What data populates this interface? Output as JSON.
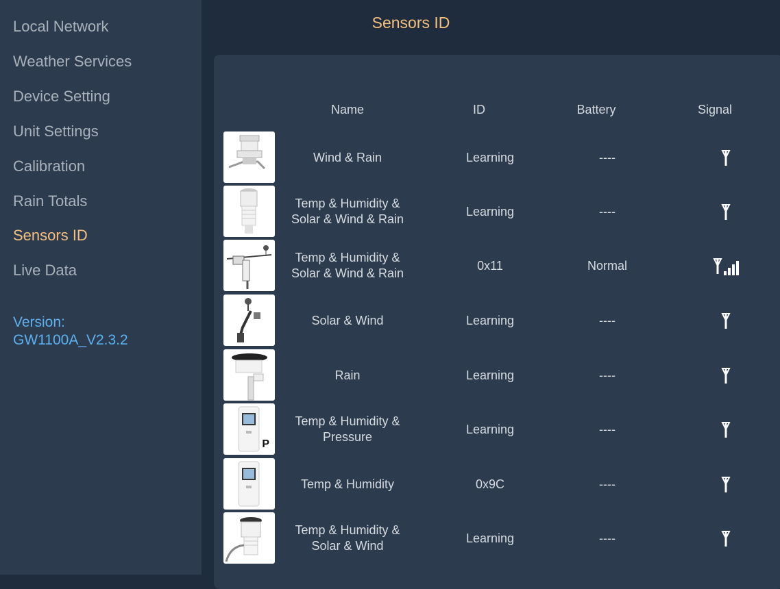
{
  "sidebar": {
    "items": [
      {
        "label": "Local Network"
      },
      {
        "label": "Weather Services"
      },
      {
        "label": "Device Setting"
      },
      {
        "label": "Unit Settings"
      },
      {
        "label": "Calibration"
      },
      {
        "label": "Rain Totals"
      },
      {
        "label": "Sensors ID",
        "active": true
      },
      {
        "label": "Live Data"
      }
    ],
    "version_label": "Version:",
    "version_value": "GW1100A_V2.3.2"
  },
  "page": {
    "title": "Sensors ID"
  },
  "table": {
    "headers": {
      "name": "Name",
      "id": "ID",
      "battery": "Battery",
      "signal": "Signal"
    },
    "rows": [
      {
        "image": "wind-rain-sensor",
        "name_line1": "Wind & Rain",
        "name_line2": "",
        "id": "Learning",
        "battery": "----",
        "signal_bars": 0
      },
      {
        "image": "7in1-sensor",
        "name_line1": "Temp & Humidity &",
        "name_line2": "Solar & Wind & Rain",
        "id": "Learning",
        "battery": "----",
        "signal_bars": 0
      },
      {
        "image": "weather-station-array",
        "name_line1": "Temp & Humidity &",
        "name_line2": "Solar & Wind & Rain",
        "id": "0x11",
        "battery": "Normal",
        "signal_bars": 4
      },
      {
        "image": "solar-wind-sensor",
        "name_line1": "Solar & Wind",
        "name_line2": "",
        "id": "Learning",
        "battery": "----",
        "signal_bars": 0
      },
      {
        "image": "rain-gauge",
        "name_line1": "Rain",
        "name_line2": "",
        "id": "Learning",
        "battery": "----",
        "signal_bars": 0
      },
      {
        "image": "thp-sensor",
        "name_line1": "Temp & Humidity &",
        "name_line2": "Pressure",
        "id": "Learning",
        "battery": "----",
        "signal_bars": 0,
        "thumb_label": "P"
      },
      {
        "image": "th-sensor",
        "name_line1": "Temp & Humidity",
        "name_line2": "",
        "id": "0x9C",
        "battery": "----",
        "signal_bars": 0
      },
      {
        "image": "th-solar-wind-sensor",
        "name_line1": "Temp & Humidity &",
        "name_line2": "Solar & Wind",
        "id": "Learning",
        "battery": "----",
        "signal_bars": 0
      }
    ]
  },
  "colors": {
    "sidebar_bg": "#2c3b4e",
    "main_bg": "#1f2c3d",
    "accent": "#f4c07e",
    "version": "#5cb1ef",
    "text": "#d6dbe0",
    "nav_text": "#a9b1ba"
  }
}
